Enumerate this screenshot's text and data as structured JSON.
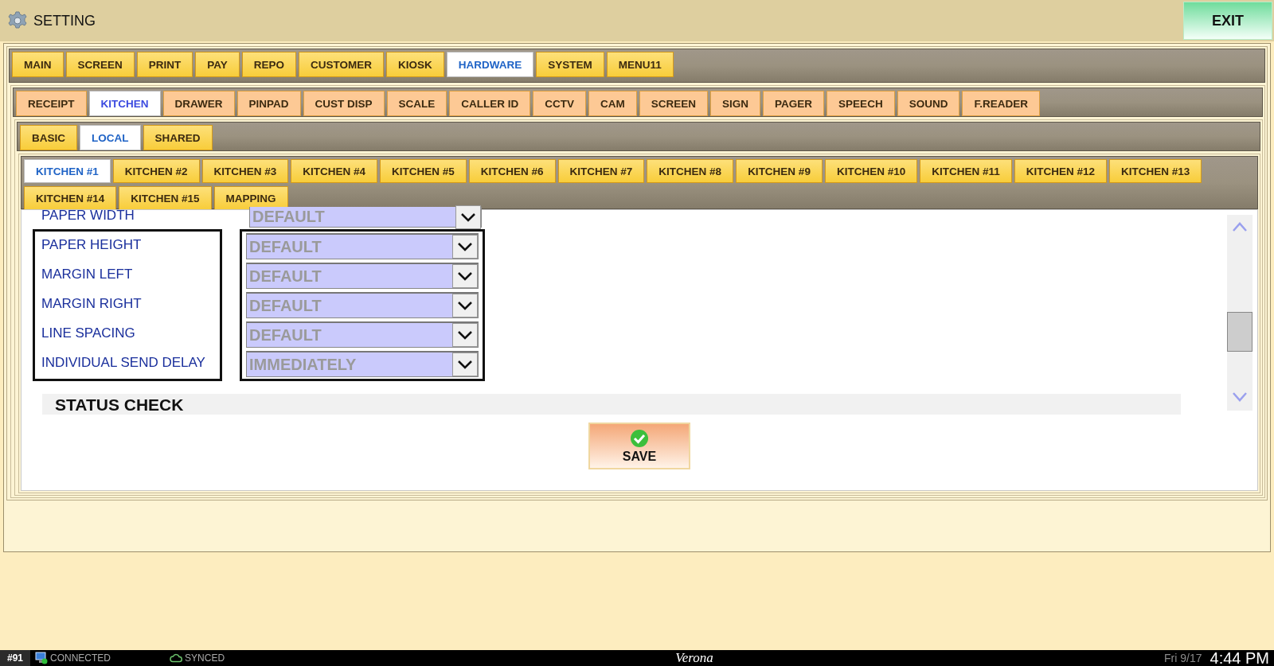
{
  "window": {
    "title": "SETTING",
    "exit_button": "EXIT"
  },
  "tab_rows": [
    {
      "tabs": [
        {
          "label": "MAIN",
          "selected": false
        },
        {
          "label": "SCREEN",
          "selected": false
        },
        {
          "label": "PRINT",
          "selected": false
        },
        {
          "label": "PAY",
          "selected": false
        },
        {
          "label": "REPO",
          "selected": false
        },
        {
          "label": "CUSTOMER",
          "selected": false
        },
        {
          "label": "KIOSK",
          "selected": false
        },
        {
          "label": "HARDWARE",
          "selected": true
        },
        {
          "label": "SYSTEM",
          "selected": false
        },
        {
          "label": "MENU11",
          "selected": false
        }
      ]
    },
    {
      "tabs": [
        {
          "label": "RECEIPT",
          "selected": false
        },
        {
          "label": "KITCHEN",
          "selected": true
        },
        {
          "label": "DRAWER",
          "selected": false
        },
        {
          "label": "PINPAD",
          "selected": false
        },
        {
          "label": "CUST DISP",
          "selected": false
        },
        {
          "label": "SCALE",
          "selected": false
        },
        {
          "label": "CALLER ID",
          "selected": false
        },
        {
          "label": "CCTV",
          "selected": false
        },
        {
          "label": "CAM",
          "selected": false
        },
        {
          "label": "SCREEN",
          "selected": false
        },
        {
          "label": "SIGN",
          "selected": false
        },
        {
          "label": "PAGER",
          "selected": false
        },
        {
          "label": "SPEECH",
          "selected": false
        },
        {
          "label": "SOUND",
          "selected": false
        },
        {
          "label": "F.READER",
          "selected": false
        }
      ]
    },
    {
      "tabs": [
        {
          "label": "BASIC",
          "selected": false
        },
        {
          "label": "LOCAL",
          "selected": true
        },
        {
          "label": "SHARED",
          "selected": false
        }
      ]
    },
    {
      "tabs": [
        {
          "label": "KITCHEN #1",
          "selected": true
        },
        {
          "label": "KITCHEN #2",
          "selected": false
        },
        {
          "label": "KITCHEN #3",
          "selected": false
        },
        {
          "label": "KITCHEN #4",
          "selected": false
        },
        {
          "label": "KITCHEN #5",
          "selected": false
        },
        {
          "label": "KITCHEN #6",
          "selected": false
        },
        {
          "label": "KITCHEN #7",
          "selected": false
        },
        {
          "label": "KITCHEN #8",
          "selected": false
        },
        {
          "label": "KITCHEN #9",
          "selected": false
        },
        {
          "label": "KITCHEN #10",
          "selected": false
        },
        {
          "label": "KITCHEN #11",
          "selected": false
        },
        {
          "label": "KITCHEN #12",
          "selected": false
        },
        {
          "label": "KITCHEN #13",
          "selected": false
        },
        {
          "label": "KITCHEN #14",
          "selected": false
        },
        {
          "label": "KITCHEN #15",
          "selected": false
        },
        {
          "label": "MAPPING",
          "selected": false
        }
      ]
    }
  ],
  "settings": {
    "rows": [
      {
        "label": "PAPER WIDTH",
        "value": "DEFAULT",
        "highlighted": false
      },
      {
        "label": "PAPER HEIGHT",
        "value": "DEFAULT",
        "highlighted": true
      },
      {
        "label": "MARGIN LEFT",
        "value": "DEFAULT",
        "highlighted": true
      },
      {
        "label": "MARGIN RIGHT",
        "value": "DEFAULT",
        "highlighted": true
      },
      {
        "label": "LINE SPACING",
        "value": "DEFAULT",
        "highlighted": true
      },
      {
        "label": "INDIVIDUAL SEND DELAY",
        "value": "IMMEDIATELY",
        "highlighted": true
      }
    ],
    "section_heading": "STATUS CHECK",
    "save_button": "SAVE"
  },
  "status_bar": {
    "station": "#91",
    "connection": "CONNECTED",
    "sync": "SYNCED",
    "store": "Verona",
    "date": "Fri 9/17",
    "time": "4:44 PM"
  }
}
